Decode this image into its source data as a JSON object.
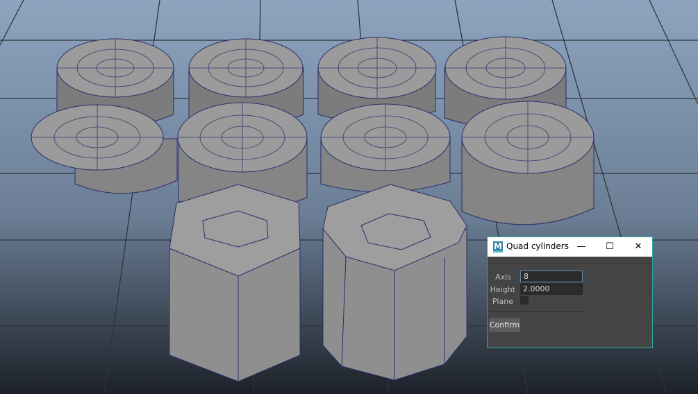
{
  "viewport": {
    "scene_colors": {
      "sky_top": "#8fa6c0",
      "sky_bottom": "#1d232b",
      "grid": "#2e3238",
      "face_top": "#9b9b9b",
      "face_side_light": "#8a8a8a",
      "face_side_dark": "#6e6e6e",
      "wire": "#2a2c6a"
    }
  },
  "dialog": {
    "title": "Quad cylinders",
    "icon_letter": "M",
    "minimize_glyph": "—",
    "maximize_glyph": "☐",
    "close_glyph": "✕",
    "fields": {
      "axis_label": "Axis",
      "axis_value": "8",
      "height_label": "Height",
      "height_value": "2.0000",
      "plane_label": "Plane",
      "plane_checked": false
    },
    "confirm_label": "Confirm",
    "accent": "#2aa9a0"
  }
}
